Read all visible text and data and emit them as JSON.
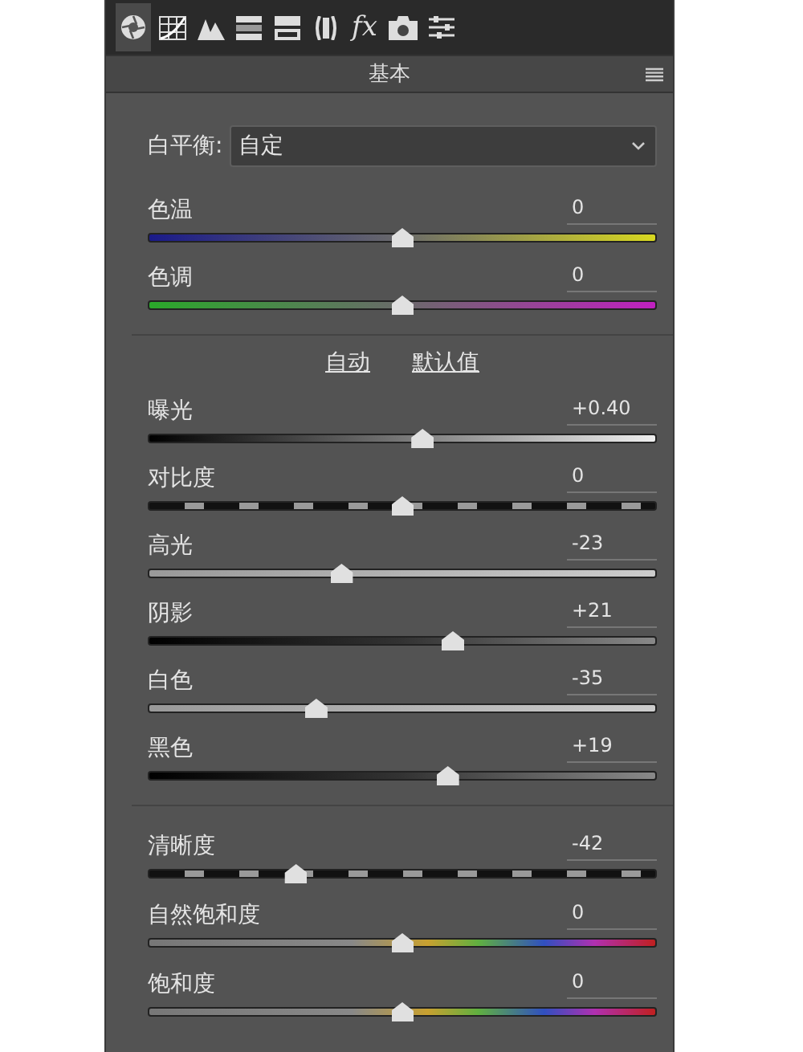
{
  "toolbar": [
    {
      "kind": "aperture",
      "selected": true
    },
    {
      "kind": "curve",
      "selected": false
    },
    {
      "kind": "mountains",
      "selected": false
    },
    {
      "kind": "bars",
      "selected": false
    },
    {
      "kind": "split",
      "selected": false
    },
    {
      "kind": "lens",
      "selected": false
    },
    {
      "kind": "fx",
      "label": "fx",
      "selected": false
    },
    {
      "kind": "camera",
      "selected": false
    },
    {
      "kind": "sliders",
      "selected": false
    }
  ],
  "panel": {
    "title": "基本"
  },
  "white_balance": {
    "label": "白平衡:",
    "value": "自定"
  },
  "sections": [
    {
      "sliders": [
        {
          "name": "色温",
          "reading": "0",
          "level": 0.5,
          "kind": "temperature"
        },
        {
          "name": "色调",
          "reading": "0",
          "level": 0.5,
          "kind": "tint"
        }
      ]
    },
    {
      "links": [
        "自动",
        "默认值"
      ],
      "sliders": [
        {
          "name": "曝光",
          "reading": "+0.40",
          "level": 0.54,
          "kind": "ramp"
        },
        {
          "name": "对比度",
          "reading": "0",
          "level": 0.5,
          "kind": "contrast"
        },
        {
          "name": "高光",
          "reading": "-23",
          "level": 0.38,
          "kind": "light"
        },
        {
          "name": "阴影",
          "reading": "+21",
          "level": 0.6,
          "kind": "dark"
        },
        {
          "name": "白色",
          "reading": "-35",
          "level": 0.33,
          "kind": "light"
        },
        {
          "name": "黑色",
          "reading": "+19",
          "level": 0.59,
          "kind": "dark"
        }
      ]
    },
    {
      "sliders": [
        {
          "name": "清晰度",
          "reading": "-42",
          "level": 0.29,
          "kind": "contrast"
        },
        {
          "name": "自然饱和度",
          "reading": "0",
          "level": 0.5,
          "kind": "spectrum"
        },
        {
          "name": "饱和度",
          "reading": "0",
          "level": 0.5,
          "kind": "spectrum"
        }
      ]
    }
  ]
}
